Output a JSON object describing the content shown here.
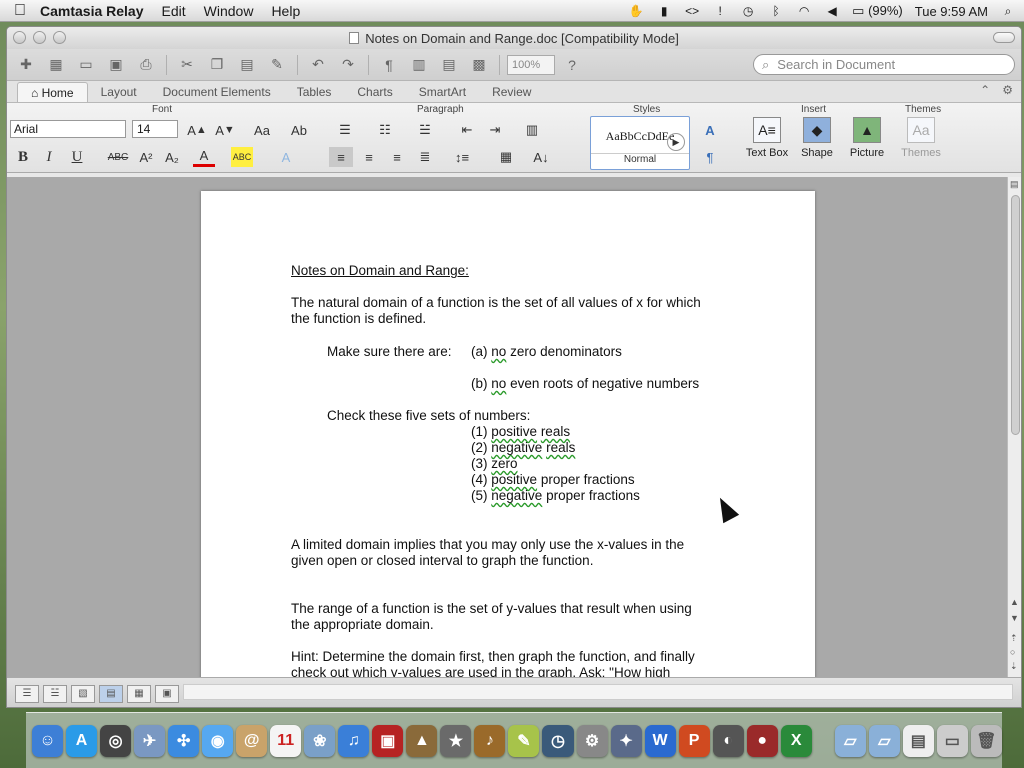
{
  "menubar": {
    "app_name": "Camtasia Relay",
    "menus": [
      "Edit",
      "Window",
      "Help"
    ],
    "battery": "(99%)",
    "clock": "Tue 9:59 AM"
  },
  "window": {
    "title": "Notes on Domain and Range.doc [Compatibility Mode]",
    "zoom": "100%",
    "search_placeholder": "Search in Document"
  },
  "ribbon_tabs": [
    "Home",
    "Layout",
    "Document Elements",
    "Tables",
    "Charts",
    "SmartArt",
    "Review"
  ],
  "ribbon": {
    "group_font": "Font",
    "group_paragraph": "Paragraph",
    "group_styles": "Styles",
    "group_insert": "Insert",
    "group_themes": "Themes",
    "font_name": "Arial",
    "font_size": "14",
    "style_sample": "AaBbCcDdEe",
    "style_name": "Normal",
    "insert_textbox": "Text Box",
    "insert_shape": "Shape",
    "insert_picture": "Picture",
    "themes_label": "Themes"
  },
  "document": {
    "title": "Notes on Domain and Range:",
    "p1_l1": "The natural domain of a function is the set of all values of x for which",
    "p1_l2": "the function is defined.",
    "make_sure": "Make sure there are:",
    "a_label": "(a)",
    "a_no": "no",
    "a_rest": "zero denominators",
    "b_label": "(b)",
    "b_no": "no",
    "b_rest": "even roots of negative numbers",
    "check": "Check these five sets of numbers:",
    "items": [
      {
        "num": "(1)",
        "w1": "positive",
        "w2": "reals",
        "rest": ""
      },
      {
        "num": "(2)",
        "w1": "negative",
        "w2": "reals",
        "rest": ""
      },
      {
        "num": "(3)",
        "w1": "zero",
        "w2": "",
        "rest": ""
      },
      {
        "num": "(4)",
        "w1": "positive",
        "w2": "",
        "rest": "proper fractions"
      },
      {
        "num": "(5)",
        "w1": "negative",
        "w2": "",
        "rest": "proper fractions"
      }
    ],
    "p2_l1": "A limited domain implies that you may only use the x-values in the",
    "p2_l2": "given open or closed interval to graph the function.",
    "p3_l1": "The range of a function is the set of y-values that result when using",
    "p3_l2": "the appropriate domain.",
    "p4_l1": "Hint:  Determine the domain first, then graph the function, and finally",
    "p4_l2": "check out which y-values are used in the graph.  Ask:  \"How high"
  }
}
